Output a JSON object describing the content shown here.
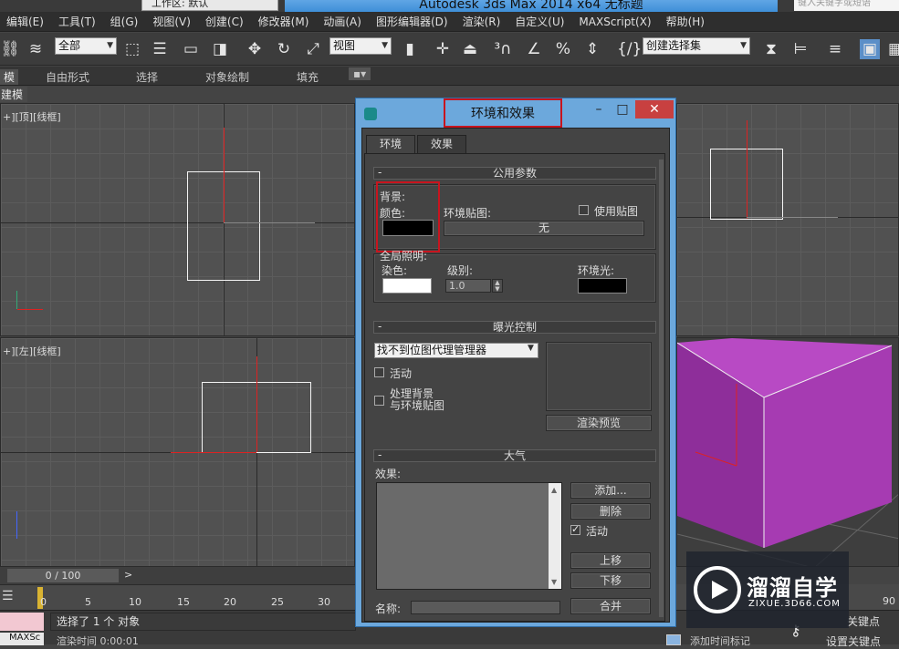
{
  "titlebar": {
    "workspace": "工作区: 默认",
    "app_title": "Autodesk 3ds Max  2014 x64       无标题",
    "search_placeholder": "键入关键字或短语"
  },
  "menu": [
    "编辑(E)",
    "工具(T)",
    "组(G)",
    "视图(V)",
    "创建(C)",
    "修改器(M)",
    "动画(A)",
    "图形编辑器(D)",
    "渲染(R)",
    "自定义(U)",
    "MAXScript(X)",
    "帮助(H)"
  ],
  "toolbar": {
    "filter_select": "全部",
    "refcoord_select": "视图",
    "selset_select": "创建选择集"
  },
  "ribbon": {
    "tabs": [
      "模",
      "自由形式",
      "选择",
      "对象绘制",
      "填充"
    ],
    "panel_label": "建模"
  },
  "viewports": {
    "top_label": "+][顶][线框]",
    "left_label": "+][左][线框]"
  },
  "timeline": {
    "frame": "0 / 100",
    "ticks": [
      "0",
      "5",
      "10",
      "15",
      "20",
      "25",
      "30"
    ],
    "end_tick": "90"
  },
  "status": {
    "maxscript_label": "MAXSc",
    "message": "选择了 1 个 对象",
    "render_time": "渲染时间  0:00:01",
    "add_tag": "添加时间标记",
    "auto_key": "关键点",
    "set_key": "设置关键点"
  },
  "dialog": {
    "title": "环境和效果",
    "tabs": [
      "环境",
      "效果"
    ],
    "common_params": {
      "header": "公用参数",
      "background_label": "背景:",
      "color_label": "颜色:",
      "env_map_label": "环境贴图:",
      "use_map_label": "使用贴图",
      "map_button": "无",
      "bg_color": "#000000",
      "global_lighting_label": "全局照明:",
      "tint_label": "染色:",
      "level_label": "级别:",
      "level_value": "1.0",
      "ambient_label": "环境光:",
      "tint_color": "#ffffff",
      "ambient_color": "#000000"
    },
    "exposure": {
      "header": "曝光控制",
      "select_value": "找不到位图代理管理器",
      "active_label": "活动",
      "process_line1": "处理背景",
      "process_line2": "与环境贴图",
      "render_preview": "渲染预览"
    },
    "atmosphere": {
      "header": "大气",
      "effects_label": "效果:",
      "add_button": "添加...",
      "delete_button": "删除",
      "active_label": "活动",
      "move_up": "上移",
      "move_down": "下移",
      "name_label": "名称:",
      "merge_button": "合并"
    }
  },
  "watermark": {
    "brand": "溜溜自学",
    "url": "ZIXUE.3D66.COM"
  },
  "colors": {
    "cube": "#a63bb2",
    "highlight": "#c8141e",
    "title_blue": "#6ca8dc"
  }
}
